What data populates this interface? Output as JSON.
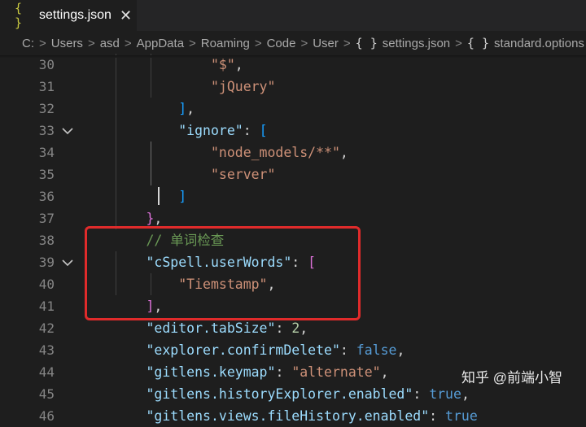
{
  "tab": {
    "icon": "{ }",
    "label": "settings.json",
    "close": "✕"
  },
  "breadcrumb": {
    "segments": [
      "C:",
      "Users",
      "asd",
      "AppData",
      "Roaming",
      "Code",
      "User",
      "settings.json",
      "standard.options"
    ],
    "separator": ">",
    "braces_icon": "{ }",
    "object_icon": "{ }"
  },
  "lines": [
    {
      "n": "30",
      "tokens": [
        [
          "                ",
          "p"
        ],
        [
          "\"$\"",
          "s"
        ],
        [
          ",",
          "p"
        ]
      ]
    },
    {
      "n": "31",
      "tokens": [
        [
          "                ",
          "p"
        ],
        [
          "\"jQuery\"",
          "s"
        ]
      ]
    },
    {
      "n": "32",
      "tokens": [
        [
          "            ",
          "p"
        ],
        [
          "]",
          "b3"
        ],
        [
          ",",
          "p"
        ]
      ]
    },
    {
      "n": "33",
      "tokens": [
        [
          "            ",
          "p"
        ],
        [
          "\"ignore\"",
          "k"
        ],
        [
          ": ",
          "p"
        ],
        [
          "[",
          "b3"
        ]
      ]
    },
    {
      "n": "34",
      "tokens": [
        [
          "                ",
          "p"
        ],
        [
          "\"node_models/**\"",
          "s"
        ],
        [
          ",",
          "p"
        ]
      ]
    },
    {
      "n": "35",
      "tokens": [
        [
          "                ",
          "p"
        ],
        [
          "\"server\"",
          "s"
        ]
      ]
    },
    {
      "n": "36",
      "tokens": [
        [
          "            ",
          "p"
        ],
        [
          "]",
          "b3"
        ]
      ]
    },
    {
      "n": "37",
      "tokens": [
        [
          "        ",
          "p"
        ],
        [
          "}",
          "b2"
        ],
        [
          ",",
          "p"
        ]
      ]
    },
    {
      "n": "38",
      "tokens": [
        [
          "        ",
          "p"
        ],
        [
          "// 单词检查",
          "c"
        ]
      ]
    },
    {
      "n": "39",
      "tokens": [
        [
          "        ",
          "p"
        ],
        [
          "\"cSpell.userWords\"",
          "k"
        ],
        [
          ": ",
          "p"
        ],
        [
          "[",
          "b2"
        ]
      ]
    },
    {
      "n": "40",
      "tokens": [
        [
          "            ",
          "p"
        ],
        [
          "\"Tiemstamp\"",
          "s"
        ],
        [
          ",",
          "p"
        ]
      ]
    },
    {
      "n": "41",
      "tokens": [
        [
          "        ",
          "p"
        ],
        [
          "]",
          "b2"
        ],
        [
          ",",
          "p"
        ]
      ]
    },
    {
      "n": "42",
      "tokens": [
        [
          "        ",
          "p"
        ],
        [
          "\"editor.tabSize\"",
          "k"
        ],
        [
          ": ",
          "p"
        ],
        [
          "2",
          "num"
        ],
        [
          ",",
          "p"
        ]
      ]
    },
    {
      "n": "43",
      "tokens": [
        [
          "        ",
          "p"
        ],
        [
          "\"explorer.confirmDelete\"",
          "k"
        ],
        [
          ": ",
          "p"
        ],
        [
          "false",
          "bool"
        ],
        [
          ",",
          "p"
        ]
      ]
    },
    {
      "n": "44",
      "tokens": [
        [
          "        ",
          "p"
        ],
        [
          "\"gitlens.keymap\"",
          "k"
        ],
        [
          ": ",
          "p"
        ],
        [
          "\"alternate\"",
          "s"
        ],
        [
          ",",
          "p"
        ]
      ]
    },
    {
      "n": "45",
      "tokens": [
        [
          "        ",
          "p"
        ],
        [
          "\"gitlens.historyExplorer.enabled\"",
          "k"
        ],
        [
          ": ",
          "p"
        ],
        [
          "true",
          "bool"
        ],
        [
          ",",
          "p"
        ]
      ]
    },
    {
      "n": "46",
      "tokens": [
        [
          "        ",
          "p"
        ],
        [
          "\"gitlens.views.fileHistory.enabled\"",
          "k"
        ],
        [
          ": ",
          "p"
        ],
        [
          "true",
          "bool"
        ]
      ]
    }
  ],
  "fold_lines": [
    "33",
    "39"
  ],
  "watermark": "知乎 @前端小智",
  "colors": {
    "p": "#d4d4d4",
    "s": "#ce9178",
    "k": "#9cdcfe",
    "c": "#6a9955",
    "b2": "#da70d6",
    "b3": "#179fff",
    "num": "#b5cea8",
    "bool": "#569cd6",
    "accent_box": "#e02b2b"
  }
}
